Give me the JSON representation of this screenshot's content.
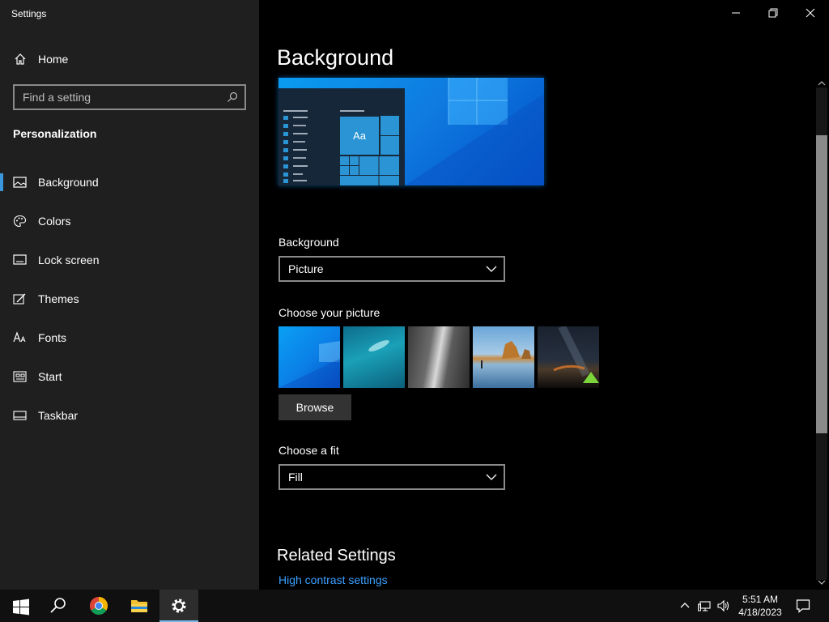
{
  "window": {
    "title": "Settings"
  },
  "sidebar": {
    "home_label": "Home",
    "search_placeholder": "Find a setting",
    "section_title": "Personalization",
    "items": [
      {
        "label": "Background",
        "icon": "picture-icon",
        "active": true
      },
      {
        "label": "Colors",
        "icon": "palette-icon"
      },
      {
        "label": "Lock screen",
        "icon": "lock-screen-icon"
      },
      {
        "label": "Themes",
        "icon": "themes-brush-icon"
      },
      {
        "label": "Fonts",
        "icon": "fonts-icon"
      },
      {
        "label": "Start",
        "icon": "start-grid-icon"
      },
      {
        "label": "Taskbar",
        "icon": "taskbar-icon"
      }
    ]
  },
  "main": {
    "title": "Background",
    "preview_tile_text": "Aa",
    "background_label": "Background",
    "background_value": "Picture",
    "choose_picture_label": "Choose your picture",
    "browse_label": "Browse",
    "fit_label": "Choose a fit",
    "fit_value": "Fill",
    "related_title": "Related Settings",
    "related_link": "High contrast settings"
  },
  "taskbar": {
    "time": "5:51 AM",
    "date": "4/18/2023"
  },
  "colors": {
    "accent": "#3a96dd",
    "link": "#3aa0ff",
    "sidebar_bg": "#1f1f1f",
    "main_bg": "#000000"
  }
}
